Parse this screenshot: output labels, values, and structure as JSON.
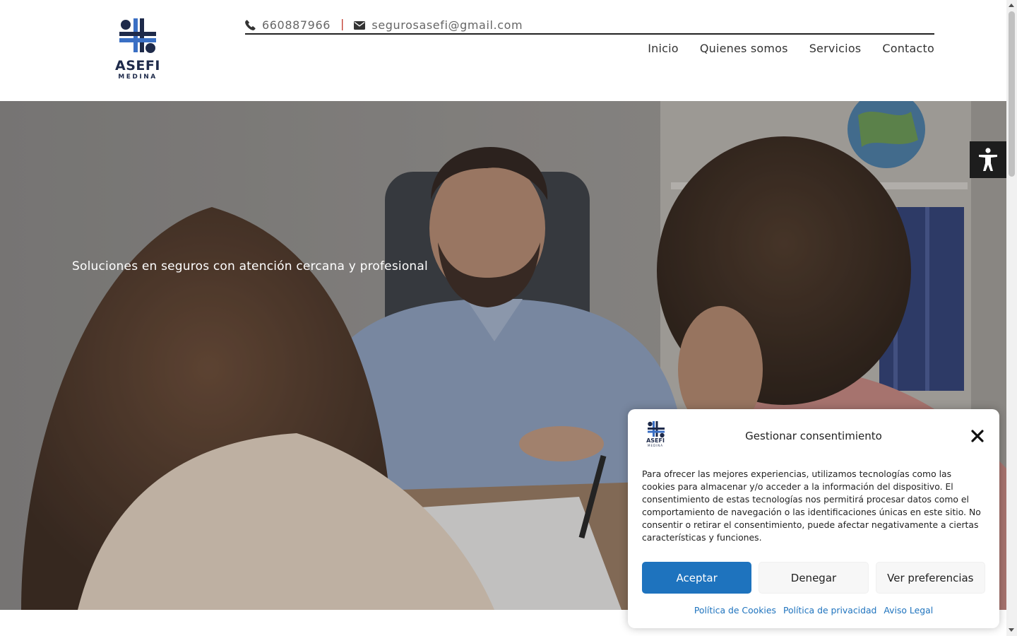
{
  "brand": {
    "name": "ASEFI",
    "sub": "MEDINA",
    "navy": "#1e2a4a",
    "blue": "#3a6fc4"
  },
  "topbar": {
    "phone": "660887966",
    "separator": "|",
    "email": "segurosasefi@gmail.com",
    "phone_icon": "phone-icon",
    "email_icon": "envelope-icon"
  },
  "nav": {
    "items": [
      {
        "label": "Inicio"
      },
      {
        "label": "Quienes somos"
      },
      {
        "label": "Servicios"
      },
      {
        "label": "Contacto"
      }
    ]
  },
  "hero": {
    "tagline": "Soluciones en seguros con atención cercana y profesional"
  },
  "accessibility": {
    "icon": "accessibility-icon"
  },
  "consent": {
    "title": "Gestionar consentimiento",
    "body": "Para ofrecer las mejores experiencias, utilizamos tecnologías como las cookies para almacenar y/o acceder a la información del dispositivo. El consentimiento de estas tecnologías nos permitirá procesar datos como el comportamiento de navegación o las identificaciones únicas en este sitio. No consentir o retirar el consentimiento, puede afectar negativamente a ciertas características y funciones.",
    "accept": "Aceptar",
    "deny": "Denegar",
    "preferences": "Ver preferencias",
    "links": {
      "cookies": "Política de Cookies",
      "privacy": "Política de privacidad",
      "legal": "Aviso Legal"
    },
    "accent": "#1e73be"
  }
}
